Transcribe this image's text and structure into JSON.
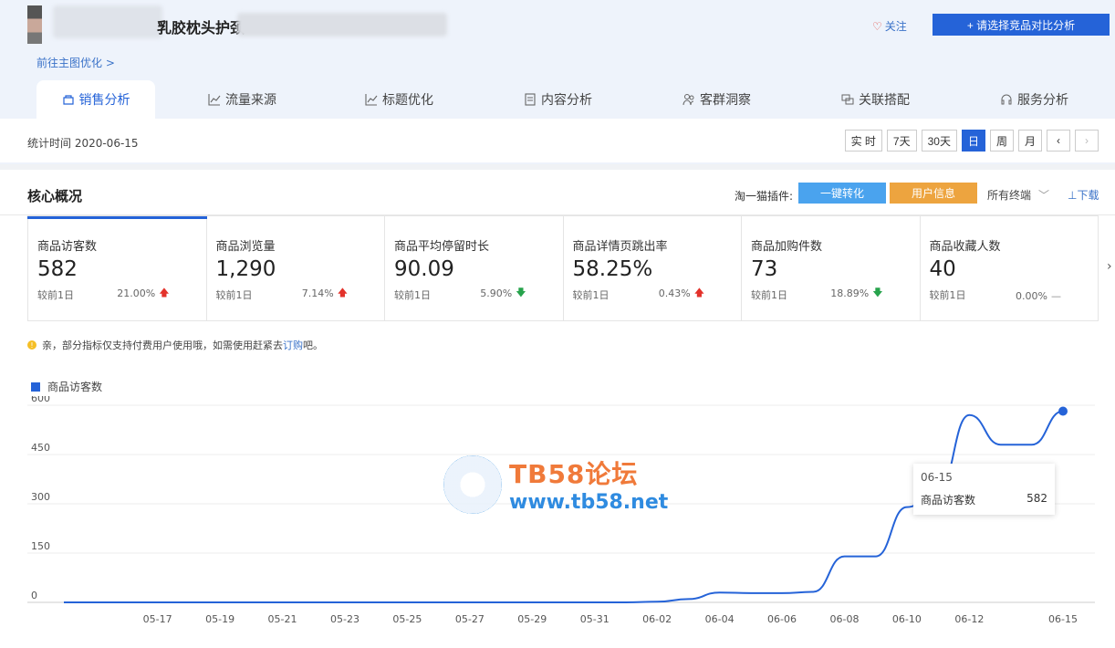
{
  "header": {
    "product_title": "乳胶枕头护颈",
    "goto_link": "前往主图优化 >",
    "follow_label": "关注",
    "compare_button": "+ 请选择竞品对比分析"
  },
  "tabs": [
    {
      "label": "销售分析",
      "icon": "shop-icon",
      "active": true
    },
    {
      "label": "流量来源",
      "icon": "trend-icon"
    },
    {
      "label": "标题优化",
      "icon": "trend-icon"
    },
    {
      "label": "内容分析",
      "icon": "document-icon"
    },
    {
      "label": "客群洞察",
      "icon": "users-icon"
    },
    {
      "label": "关联搭配",
      "icon": "link-icon"
    },
    {
      "label": "服务分析",
      "icon": "headset-icon"
    }
  ],
  "datebar": {
    "stat_time": "统计时间 2020-06-15",
    "buttons": [
      "实 时",
      "7天",
      "30天",
      "日",
      "周",
      "月"
    ],
    "active": "日"
  },
  "core": {
    "title": "核心概况",
    "plugin_label": "淘一猫插件:",
    "convert_button": "一键转化",
    "user_button": "用户信息",
    "terminals": "所有终端",
    "download": "⊥下载"
  },
  "metrics": [
    {
      "name": "商品访客数",
      "value": "582",
      "compare": "较前1日",
      "pct": "21.00%",
      "trend": "up",
      "active": true
    },
    {
      "name": "商品浏览量",
      "value": "1,290",
      "compare": "较前1日",
      "pct": "7.14%",
      "trend": "up"
    },
    {
      "name": "商品平均停留时长",
      "value": "90.09",
      "compare": "较前1日",
      "pct": "5.90%",
      "trend": "down"
    },
    {
      "name": "商品详情页跳出率",
      "value": "58.25%",
      "compare": "较前1日",
      "pct": "0.43%",
      "trend": "up"
    },
    {
      "name": "商品加购件数",
      "value": "73",
      "compare": "较前1日",
      "pct": "18.89%",
      "trend": "down"
    },
    {
      "name": "商品收藏人数",
      "value": "40",
      "compare": "较前1日",
      "pct": "0.00%",
      "trend": "flat"
    }
  ],
  "tip": {
    "text": "亲，部分指标仅支持付费用户使用哦，如需使用赶紧去",
    "link": "订购",
    "suffix": "吧。"
  },
  "watermark": {
    "line1": "TB58论坛",
    "line2": "www.tb58.net"
  },
  "tooltip": {
    "date": "06-15",
    "label": "商品访客数",
    "value": "582"
  },
  "colors": {
    "accent": "#2563d8",
    "up": "#e3322b",
    "down": "#27a34c"
  },
  "chart_data": {
    "type": "line",
    "series": [
      {
        "name": "商品访客数",
        "values": [
          0,
          0,
          0,
          0,
          0,
          0,
          0,
          0,
          0,
          0,
          0,
          0,
          0,
          0,
          0,
          0,
          0,
          0,
          0,
          2,
          10,
          30,
          28,
          28,
          32,
          140,
          140,
          290,
          340,
          570,
          480,
          480,
          582
        ]
      }
    ],
    "x": [
      "05-14",
      "05-15",
      "05-16",
      "05-17",
      "05-18",
      "05-19",
      "05-20",
      "05-21",
      "05-22",
      "05-23",
      "05-24",
      "05-25",
      "05-26",
      "05-27",
      "05-28",
      "05-29",
      "05-30",
      "05-31",
      "06-01",
      "06-02",
      "06-03",
      "06-04",
      "06-05",
      "06-06",
      "06-07",
      "06-08",
      "06-09",
      "06-10",
      "06-11",
      "06-12",
      "06-13",
      "06-14",
      "06-15"
    ],
    "x_tick_labels": [
      "05-17",
      "05-19",
      "05-21",
      "05-23",
      "05-25",
      "05-27",
      "05-29",
      "05-31",
      "06-02",
      "06-04",
      "06-06",
      "06-08",
      "06-10",
      "06-12",
      "06-15"
    ],
    "y_ticks": [
      0,
      150,
      300,
      450,
      600
    ],
    "ylim": [
      0,
      600
    ],
    "grid": true,
    "legend": "top-left"
  }
}
